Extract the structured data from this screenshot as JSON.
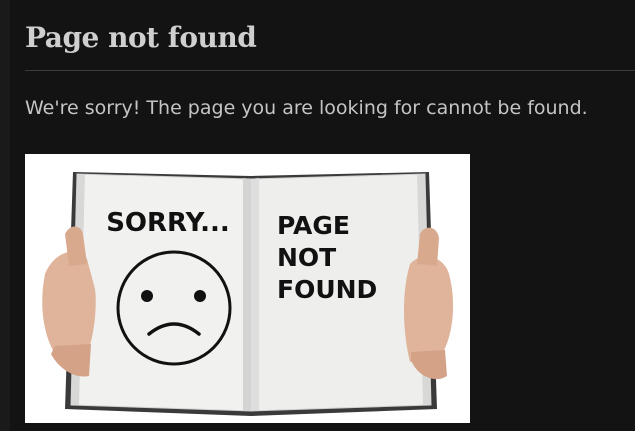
{
  "page": {
    "title": "Page not found",
    "message": "We're sorry! The page you are looking for cannot be found."
  },
  "illustration": {
    "left_page_text": "SORRY...",
    "right_page_lines": [
      "PAGE",
      "NOT",
      "FOUND"
    ]
  },
  "colors": {
    "background": "#131313",
    "sidebar": "#1a1a1a",
    "title": "#cfcfcf",
    "text": "#c4c4c4",
    "rule": "#3c3c3c"
  }
}
